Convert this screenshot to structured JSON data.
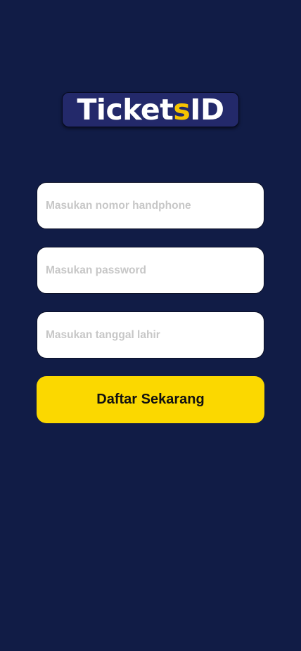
{
  "logo": {
    "text_main": "Ticket",
    "text_accent": "s",
    "text_suffix": " ID",
    "accent_color": "#f6c400",
    "background_color": "#23296a"
  },
  "form": {
    "phone_placeholder": "Masukan nomor handphone",
    "password_placeholder": "Masukan password",
    "birthdate_placeholder": "Masukan tanggal lahir",
    "submit_label": "Daftar Sekarang"
  },
  "colors": {
    "page_background": "#111c46",
    "button_background": "#fbd800"
  }
}
